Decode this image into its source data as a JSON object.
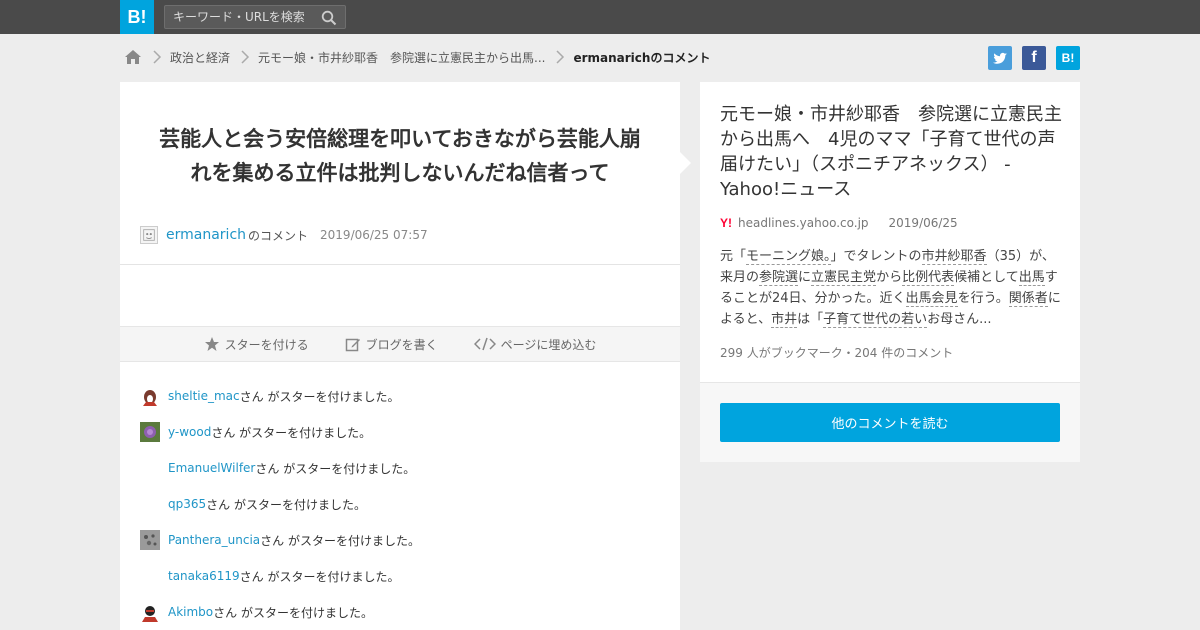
{
  "header": {
    "logo": "B!",
    "search_placeholder": "キーワード・URLを検索"
  },
  "breadcrumb": {
    "items": [
      "政治と経済",
      "元モー娘・市井紗耶香　参院選に立憲民主から出馬..."
    ],
    "current": "ermanarichのコメント"
  },
  "share": {
    "twitter": "t",
    "facebook": "f",
    "hatena": "B!"
  },
  "comment": {
    "text": "芸能人と会う安倍総理を叩いておきながら芸能人崩れを集める立件は批判しないんだね信者って",
    "username": "ermanarich",
    "suffix": "のコメント",
    "date": "2019/06/25 07:57"
  },
  "actions": {
    "star": "スターを付ける",
    "blog": "ブログを書く",
    "embed": "ページに埋め込む"
  },
  "stars": {
    "suffix": "さん がスターを付けました。",
    "users": [
      "sheltie_mac",
      "y-wood",
      "EmanuelWilfer",
      "qp365",
      "Panthera_uncia",
      "tanaka6119",
      "Akimbo"
    ]
  },
  "entry": {
    "title": "元モー娘・市井紗耶香　参院選に立憲民主から出馬へ　4児のママ「子育て世代の声届けたい」（スポニチアネックス） - Yahoo!ニュース",
    "source_icon": "Y!",
    "domain": "headlines.yahoo.co.jp",
    "date": "2019/06/25",
    "description_parts": [
      {
        "text": "元「",
        "kw": false
      },
      {
        "text": "モーニング娘。",
        "kw": true
      },
      {
        "text": "」でタレントの",
        "kw": false
      },
      {
        "text": "市井紗耶香",
        "kw": true
      },
      {
        "text": "（35）が、来月の",
        "kw": false
      },
      {
        "text": "参院選",
        "kw": true
      },
      {
        "text": "に",
        "kw": false
      },
      {
        "text": "立憲民主党",
        "kw": true
      },
      {
        "text": "から",
        "kw": false
      },
      {
        "text": "比例代表",
        "kw": true
      },
      {
        "text": "候補として",
        "kw": false
      },
      {
        "text": "出馬",
        "kw": true
      },
      {
        "text": "することが24日、分かった。近く",
        "kw": false
      },
      {
        "text": "出馬会見",
        "kw": true
      },
      {
        "text": "を行う。",
        "kw": false
      },
      {
        "text": "関係者",
        "kw": true
      },
      {
        "text": "によると、",
        "kw": false
      },
      {
        "text": "市井",
        "kw": true
      },
      {
        "text": "は「",
        "kw": false
      },
      {
        "text": "子育て世代の若い",
        "kw": true
      },
      {
        "text": "お母さん...",
        "kw": false
      }
    ],
    "counts": "299 人がブックマーク・204 件のコメント",
    "read_more": "他のコメントを読む"
  }
}
